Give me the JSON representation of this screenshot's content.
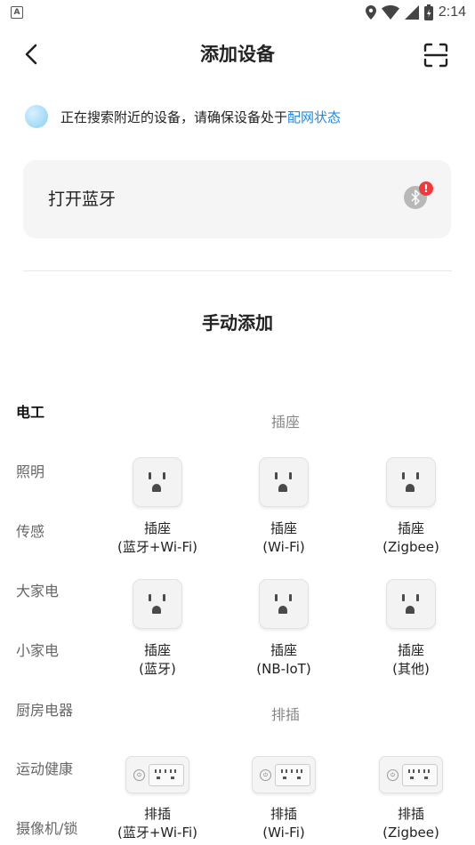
{
  "status_bar": {
    "time": "2:14",
    "left_badge": "A"
  },
  "header": {
    "title": "添加设备"
  },
  "search_notice": {
    "text": "正在搜索附近的设备，请确保设备处于",
    "link": "配网状态"
  },
  "bluetooth_card": {
    "label": "打开蓝牙",
    "alert": "!"
  },
  "manual_section": {
    "title": "手动添加"
  },
  "categories": [
    {
      "label": "电工",
      "active": true
    },
    {
      "label": "照明"
    },
    {
      "label": "传感"
    },
    {
      "label": "大家电"
    },
    {
      "label": "小家电"
    },
    {
      "label": "厨房电器"
    },
    {
      "label": "运动健康"
    },
    {
      "label": "摄像机/锁"
    }
  ],
  "groups": [
    {
      "title": "插座",
      "devices": [
        {
          "name": "插座",
          "sub": "(蓝牙+Wi-Fi)",
          "icon": "socket-icon"
        },
        {
          "name": "插座",
          "sub": "(Wi-Fi)",
          "icon": "socket-icon"
        },
        {
          "name": "插座",
          "sub": "(Zigbee)",
          "icon": "socket-icon"
        },
        {
          "name": "插座",
          "sub": "(蓝牙)",
          "icon": "socket-icon"
        },
        {
          "name": "插座",
          "sub": "(NB-IoT)",
          "icon": "socket-icon"
        },
        {
          "name": "插座",
          "sub": "(其他)",
          "icon": "socket-icon"
        }
      ]
    },
    {
      "title": "排插",
      "devices": [
        {
          "name": "排插",
          "sub": "(蓝牙+Wi-Fi)",
          "icon": "power-strip-icon"
        },
        {
          "name": "排插",
          "sub": "(Wi-Fi)",
          "icon": "power-strip-icon"
        },
        {
          "name": "排插",
          "sub": "(Zigbee)",
          "icon": "power-strip-icon"
        }
      ]
    }
  ],
  "colors": {
    "link": "#1e88e5",
    "alert": "#f2383a",
    "card_bg": "#f5f5f5"
  }
}
